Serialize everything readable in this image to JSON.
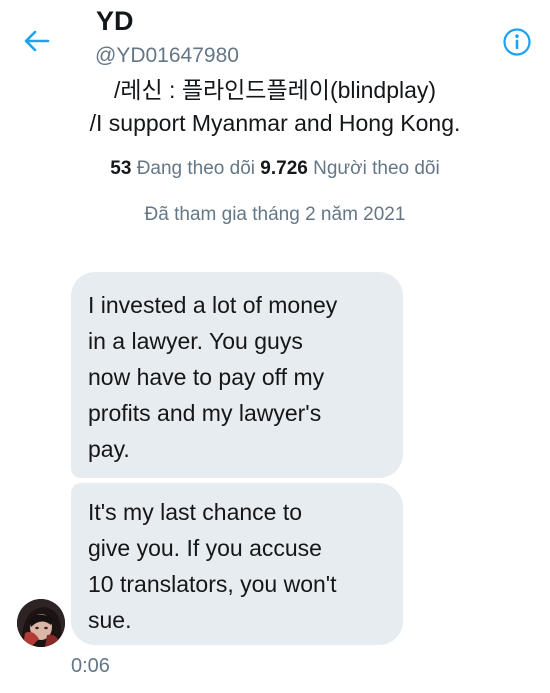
{
  "header": {
    "title": "YD",
    "handle": "@YD01647980",
    "back_icon": "arrow-left-icon",
    "info_icon": "info-circle-icon"
  },
  "profile": {
    "bio_line1": "/레신 : 플라인드플레이(blindplay)",
    "bio_line2": "/I support Myanmar and Hong Kong.",
    "following_count": "53",
    "following_label": "Đang theo dõi",
    "followers_count": "9.726",
    "followers_label": "Người theo dõi",
    "joined": "Đã tham gia tháng 2 năm 2021"
  },
  "messages": [
    {
      "lines": [
        "I invested a lot of money",
        "in a lawyer. You guys",
        "now have to pay off my",
        "profits and my lawyer's",
        "pay."
      ]
    },
    {
      "lines": [
        "It's my last chance to",
        "give you. If you accuse",
        "10 translators, you won't",
        "sue."
      ]
    }
  ],
  "timestamp": "0:06",
  "colors": {
    "accent": "#1da1f2",
    "bubble": "#e6ecf0",
    "muted": "#657786",
    "text": "#14171a"
  }
}
